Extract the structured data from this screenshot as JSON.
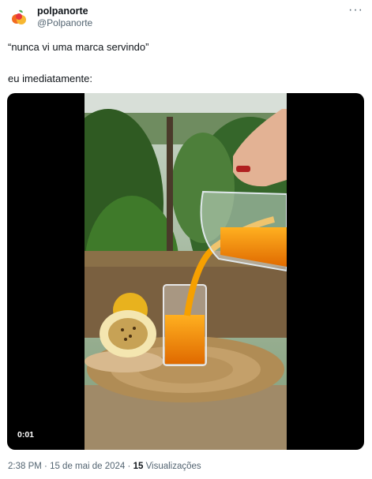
{
  "author": {
    "name": "polpanorte",
    "handle": "@Polpanorte"
  },
  "tweet": {
    "line1": "“nunca vi uma marca servindo”",
    "line2": "eu imediatamente:"
  },
  "media": {
    "timestamp": "0:01"
  },
  "meta": {
    "time": "2:38 PM",
    "sep1": " · ",
    "date": "15 de mai de 2024",
    "sep2": " · ",
    "views_count": "15",
    "views_label": " Visualizações"
  },
  "icons": {
    "more": "more-options-icon",
    "avatar": "fruit-logo"
  }
}
